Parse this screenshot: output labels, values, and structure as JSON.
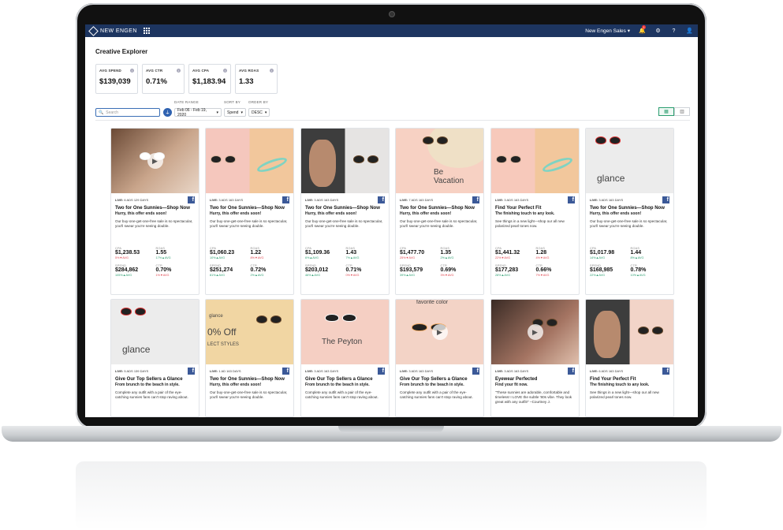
{
  "app": {
    "brand": "NEW ENGEN",
    "account": "New Engen Sales",
    "notif_count": "1",
    "help": "?",
    "page_title": "Creative Explorer"
  },
  "kpis": [
    {
      "label": "AVG SPEND",
      "value": "$139,039"
    },
    {
      "label": "AVG CTR",
      "value": "0.71%"
    },
    {
      "label": "AVG CPA",
      "value": "$1,183.94"
    },
    {
      "label": "AVG ROAS",
      "value": "1.33"
    }
  ],
  "filters": {
    "search_placeholder": "Search",
    "date_label": "DATE RANGE",
    "date_value": "Feb 06 - Feb 19, 2020",
    "sort_label": "SORT BY",
    "sort_value": "Spend",
    "order_label": "ORDER BY",
    "order_value": "DESC"
  },
  "metric_labels": {
    "cpa": "CPA",
    "roas": "ROAS",
    "spend": "SPEND",
    "ctr": "CTR"
  },
  "cards": [
    {
      "status": "LIVE:",
      "ads": "6 ADS",
      "days": "129 DAYS",
      "title": "Two for One Sunnies—Shop Now",
      "subtitle": "Hurry, this offer ends soon!",
      "body": "Our buy-one-get-one-free sale is so spectacular, you'll swear you're seeing double.",
      "cpa": "$1,238.53",
      "cpa_d": "5%▼AVG",
      "roas": "1.55",
      "roas_d": "17%▲AVG",
      "spend": "$284,862",
      "spend_d": "105%▲AVG",
      "ctr": "0.70%",
      "ctr_d": "1%▼AVG"
    },
    {
      "status": "LIVE:",
      "ads": "3 ADS",
      "days": "163 DAYS",
      "title": "Two for One Sunnies—Shop Now",
      "subtitle": "Hurry, this offer ends soon!",
      "body": "Our buy-one-get-one-free sale is so spectacular, you'll swear you're seeing double.",
      "cpa": "$1,060.23",
      "cpa_d": "10%▲AVG",
      "roas": "1.22",
      "roas_d": "8%▼AVG",
      "spend": "$251,274",
      "spend_d": "81%▲AVG",
      "ctr": "0.72%",
      "ctr_d": "2%▲AVG"
    },
    {
      "status": "LIVE:",
      "ads": "3 ADS",
      "days": "163 DAYS",
      "title": "Two for One Sunnies—Shop Now",
      "subtitle": "Hurry, this offer ends soon!",
      "body": "Our buy-one-get-one-free sale is so spectacular, you'll swear you're seeing double.",
      "cpa": "$1,109.36",
      "cpa_d": "6%▲AVG",
      "roas": "1.43",
      "roas_d": "7%▲AVG",
      "spend": "$203,012",
      "spend_d": "46%▲AVG",
      "ctr": "0.71%",
      "ctr_d": "0%▼AVG"
    },
    {
      "status": "LIVE:",
      "ads": "7 ADS",
      "days": "163 DAYS",
      "title": "Two for One Sunnies—Shop Now",
      "subtitle": "Hurry, this offer ends soon!",
      "body": "Our buy-one-get-one-free sale is so spectacular, you'll swear you're seeing double.",
      "cpa": "$1,477.70",
      "cpa_d": "25%▼AVG",
      "roas": "1.35",
      "roas_d": "2%▲AVG",
      "spend": "$193,579",
      "spend_d": "39%▲AVG",
      "ctr": "0.69%",
      "ctr_d": "3%▼AVG"
    },
    {
      "status": "LIVE:",
      "ads": "3 ADS",
      "days": "163 DAYS",
      "title": "Find Your Perfect Fit",
      "subtitle": "The finishing touch to any look.",
      "body": "See things in a new light—shop our all new polarized pearl tones now.",
      "cpa": "$1,441.32",
      "cpa_d": "22%▼AVG",
      "roas": "1.28",
      "roas_d": "4%▼AVG",
      "spend": "$177,283",
      "spend_d": "28%▲AVG",
      "ctr": "0.66%",
      "ctr_d": "7%▼AVG"
    },
    {
      "status": "LIVE:",
      "ads": "3 ADS",
      "days": "163 DAYS",
      "title": "Two for One Sunnies—Shop Now",
      "subtitle": "Hurry, this offer ends soon!",
      "body": "Our buy-one-get-one-free sale is so spectacular, you'll swear you're seeing double.",
      "cpa": "$1,017.98",
      "cpa_d": "14%▲AVG",
      "roas": "1.44",
      "roas_d": "8%▲AVG",
      "spend": "$168,985",
      "spend_d": "22%▲AVG",
      "ctr": "0.78%",
      "ctr_d": "10%▲AVG"
    },
    {
      "status": "LIVE:",
      "ads": "5 ADS",
      "days": "139 DAYS",
      "title": "Give Our Top Sellers a Glance",
      "subtitle": "From brunch to the beach in style.",
      "body": "Complete any outfit with a pair of the eye-catching sunnies fans can't stop raving about."
    },
    {
      "status": "LIVE:",
      "ads": "1 AD",
      "days": "163 DAYS",
      "title": "Two for One Sunnies—Shop Now",
      "subtitle": "Hurry, this offer ends soon!",
      "body": "Our buy-one-get-one-free sale is so spectacular, you'll swear you're seeing double."
    },
    {
      "status": "LIVE:",
      "ads": "3 ADS",
      "days": "163 DAYS",
      "title": "Give Our Top Sellers a Glance",
      "subtitle": "From brunch to the beach in style.",
      "body": "Complete any outfit with a pair of the eye-catching sunnies fans can't stop raving about."
    },
    {
      "status": "LIVE:",
      "ads": "3 ADS",
      "days": "163 DAYS",
      "title": "Give Our Top Sellers a Glance",
      "subtitle": "From brunch to the beach in style.",
      "body": "Complete any outfit with a pair of the eye-catching sunnies fans can't stop raving about."
    },
    {
      "status": "LIVE:",
      "ads": "3 ADS",
      "days": "163 DAYS",
      "title": "Eyewear Perfected",
      "subtitle": "Find your fit now.",
      "body": "\"These sunnies are adorable, comfortable and timeless! I LOVE the subtle '80s vibe. They look great with any outfit!\" –Courtney J."
    },
    {
      "status": "LIVE:",
      "ads": "6 ADS",
      "days": "163 DAYS",
      "title": "Find Your Perfect Fit",
      "subtitle": "The finishing touch to any look.",
      "body": "See things in a new light—shop our all new polarized pearl tones now."
    }
  ],
  "thumb_text": {
    "be_vacation": "Be\nVacation",
    "glance": "glance",
    "off": "0% Off",
    "styles": "LECT STYLES",
    "peyton": "The Peyton",
    "favorite": "favorite color"
  }
}
